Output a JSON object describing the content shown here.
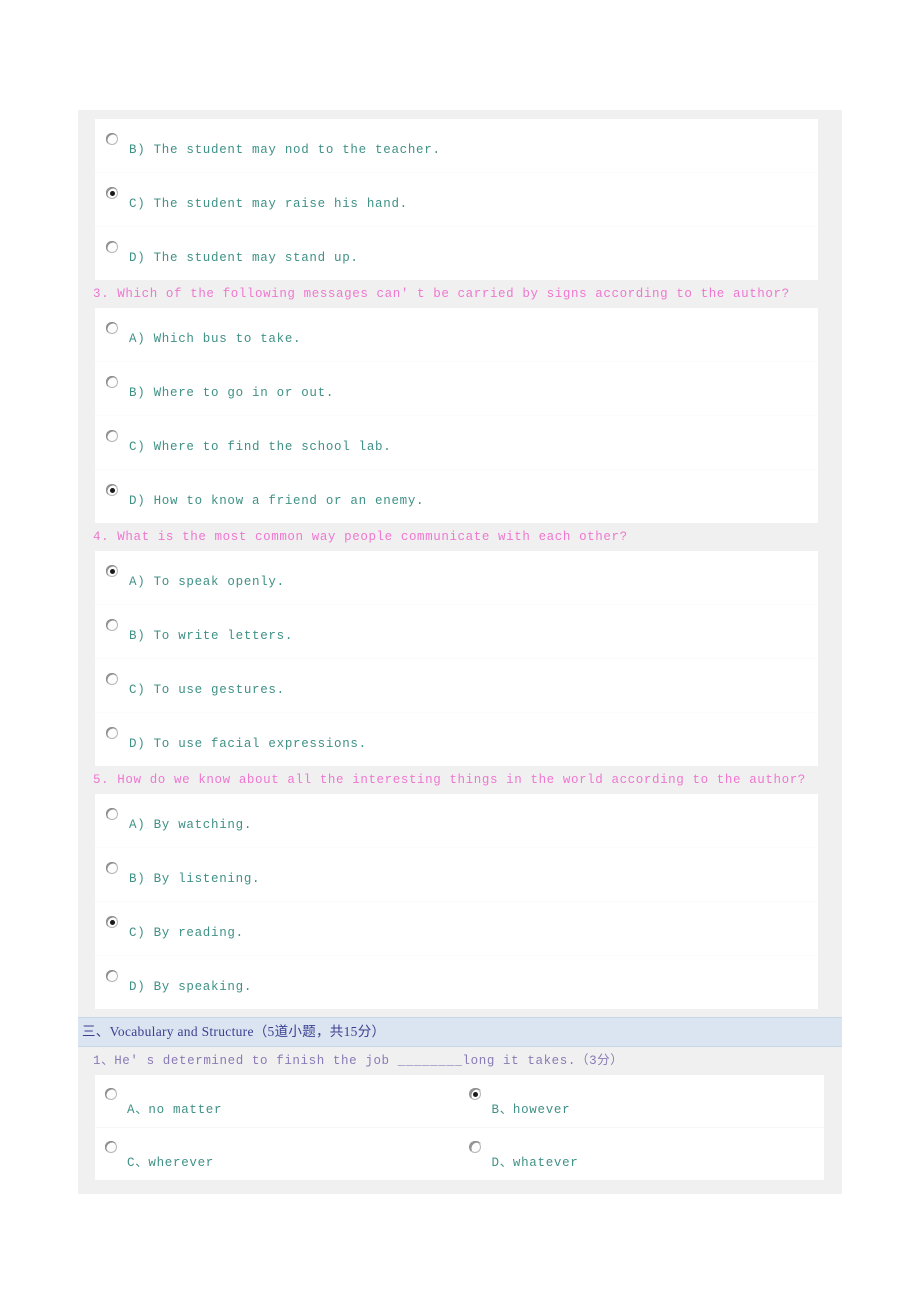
{
  "reading_section": {
    "question_2_tail_options": [
      {
        "id": "B",
        "label": "B) The student may nod to the teacher.",
        "checked": false
      },
      {
        "id": "C",
        "label": "C) The student may raise his hand.",
        "checked": true
      },
      {
        "id": "D",
        "label": "D) The student may stand up.",
        "checked": false
      }
    ],
    "questions": [
      {
        "title": "3. Which of the following messages can' t be carried by signs according to the author?",
        "options": [
          {
            "id": "A",
            "label": "A) Which bus to take.",
            "checked": false
          },
          {
            "id": "B",
            "label": "B) Where to go in or out.",
            "checked": false
          },
          {
            "id": "C",
            "label": "C) Where to find the school lab.",
            "checked": false
          },
          {
            "id": "D",
            "label": "D) How to know a friend or an enemy.",
            "checked": true
          }
        ]
      },
      {
        "title": "4. What is the most common way people communicate with each other?",
        "options": [
          {
            "id": "A",
            "label": "A) To speak openly.",
            "checked": true
          },
          {
            "id": "B",
            "label": "B) To write letters.",
            "checked": false
          },
          {
            "id": "C",
            "label": "C) To use gestures.",
            "checked": false
          },
          {
            "id": "D",
            "label": "D) To use facial expressions.",
            "checked": false
          }
        ]
      },
      {
        "title": "5. How do we know about all the interesting things in the world according to the author?",
        "options": [
          {
            "id": "A",
            "label": "A) By watching.",
            "checked": false
          },
          {
            "id": "B",
            "label": "B) By listening.",
            "checked": false
          },
          {
            "id": "C",
            "label": "C) By reading.",
            "checked": true
          },
          {
            "id": "D",
            "label": "D) By speaking.",
            "checked": false
          }
        ]
      }
    ]
  },
  "vocabulary_section": {
    "header": "三、Vocabulary and Structure（5道小题，共15分）",
    "question": {
      "title": "1、He' s determined to finish the job ________long it takes.（3分）",
      "options": [
        {
          "id": "A",
          "label": "A、no matter",
          "checked": false
        },
        {
          "id": "B",
          "label": "B、however",
          "checked": true
        },
        {
          "id": "C",
          "label": "C、wherever",
          "checked": false
        },
        {
          "id": "D",
          "label": "D、whatever",
          "checked": false
        }
      ]
    }
  },
  "colors": {
    "question_pink": "#ee77d0",
    "question_purple": "#8a7ab5",
    "option_teal": "#3f9186",
    "section_bar_bg": "#dbe5f1",
    "section_bar_text": "#3b3f8f",
    "page_bg": "#f0f0f0"
  }
}
